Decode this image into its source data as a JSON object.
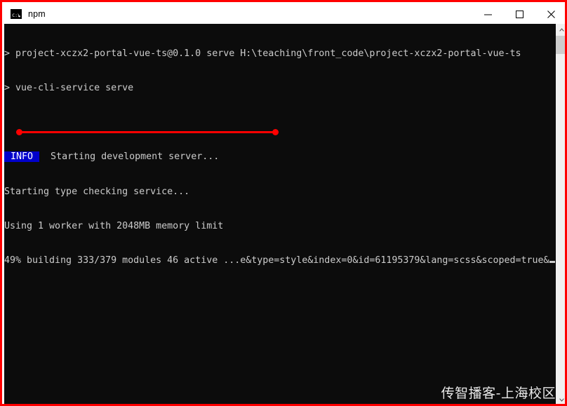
{
  "window": {
    "title": "npm",
    "icon": "console-window-icon",
    "border_color": "#ff0000",
    "controls": [
      {
        "name": "minimize-button",
        "glyph": "minimize-icon",
        "label": "Minimize"
      },
      {
        "name": "maximize-button",
        "glyph": "maximize-icon",
        "label": "Maximize"
      },
      {
        "name": "close-button",
        "glyph": "close-icon",
        "label": "Close"
      }
    ]
  },
  "console": {
    "background_color": "#0c0c0c",
    "foreground_color": "#cccccc",
    "lines": [
      {
        "type": "plain",
        "text": "> project-xczx2-portal-vue-ts@0.1.0 serve H:\\teaching\\front_code\\project-xczx2-portal-vue-ts"
      },
      {
        "type": "plain",
        "text": "> vue-cli-service serve"
      },
      {
        "type": "plain",
        "text": ""
      },
      {
        "type": "badge",
        "badge": " INFO ",
        "badge_color": "#0000cc",
        "text": "  Starting development server..."
      },
      {
        "type": "plain",
        "text": "Starting type checking service..."
      },
      {
        "type": "plain",
        "text": "Using 1 worker with 2048MB memory limit"
      },
      {
        "type": "cursor",
        "text": "49% building 333/379 modules 46 active ...e&type=style&index=0&id=61195379&lang=scss&scoped=true&"
      }
    ]
  },
  "scrollbar": {
    "up_arrow": "chevron-up-icon",
    "down_arrow": "chevron-down-icon",
    "thumb": "scroll-thumb"
  },
  "annotation": {
    "color": "#ff0000",
    "kind": "underline-with-endpoints",
    "target_line": "49% building 333/379 modules 46 active"
  },
  "watermark": {
    "text": "传智播客-上海校区"
  }
}
